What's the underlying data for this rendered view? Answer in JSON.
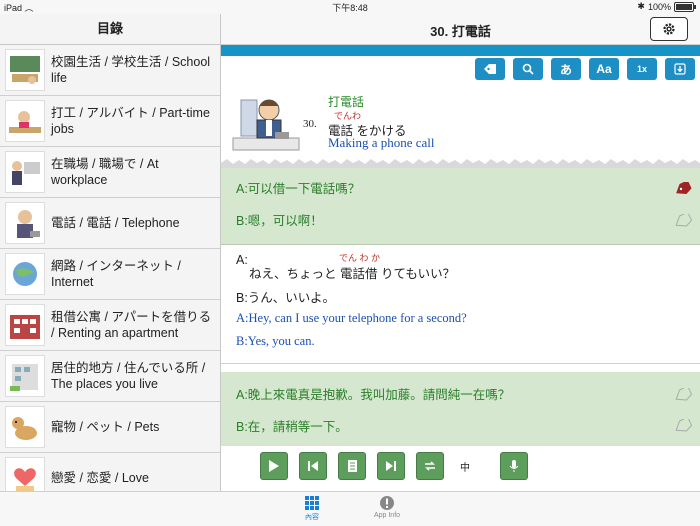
{
  "status": {
    "time": "下午8:48",
    "battery": "100%"
  },
  "sidebar": {
    "title": "目錄",
    "items": [
      {
        "label": "校園生活 / 学校生活 / School life"
      },
      {
        "label": "打工 / アルバイト / Part-time jobs"
      },
      {
        "label": "在職場 / 職場で / At workplace"
      },
      {
        "label": "電話 / 電話 / Telephone"
      },
      {
        "label": "網路 / インターネット / Internet"
      },
      {
        "label": "租借公寓 / アパートを借りる / Renting an apartment"
      },
      {
        "label": "居住的地方 / 住んでいる所 / The places you live"
      },
      {
        "label": "寵物 / ペット / Pets"
      },
      {
        "label": "戀愛 / 恋愛 / Love"
      }
    ]
  },
  "main": {
    "title": "30. 打電話",
    "toolbar": {
      "kana": "あ",
      "font": "Aa",
      "speed": "1x"
    },
    "lesson": {
      "number": "30.",
      "zh": "打電話",
      "ruby": "でんわ",
      "ja": "電話 をかける",
      "en": "Making a phone call"
    },
    "dialog1": {
      "a": "A:可以借一下電話嗎？",
      "b": "B:嗯，可以啊！"
    },
    "dialog2": {
      "a_label": "A:",
      "a_ruby": "でん わ か",
      "a_ja": "ねえ、ちょっと 電話借 りてもいい？",
      "b_ja": "B:うん、いいよ。",
      "a_en": "A:Hey, can I use your telephone for a second?",
      "b_en": "B:Yes, you can."
    },
    "dialog3": {
      "a": "A:晚上來電真是抱歉。我叫加藤。請問純一在嗎？",
      "b": "B:在，請稍等一下。"
    }
  },
  "player": {
    "lang": "中"
  },
  "tabs": [
    {
      "label": "內容"
    },
    {
      "label": "App Info"
    }
  ],
  "colors": {
    "accent": "#1794c7",
    "green_panel": "#d5e8cf",
    "player_green": "#5d9e5d",
    "tab_active": "#1a7fd4"
  }
}
